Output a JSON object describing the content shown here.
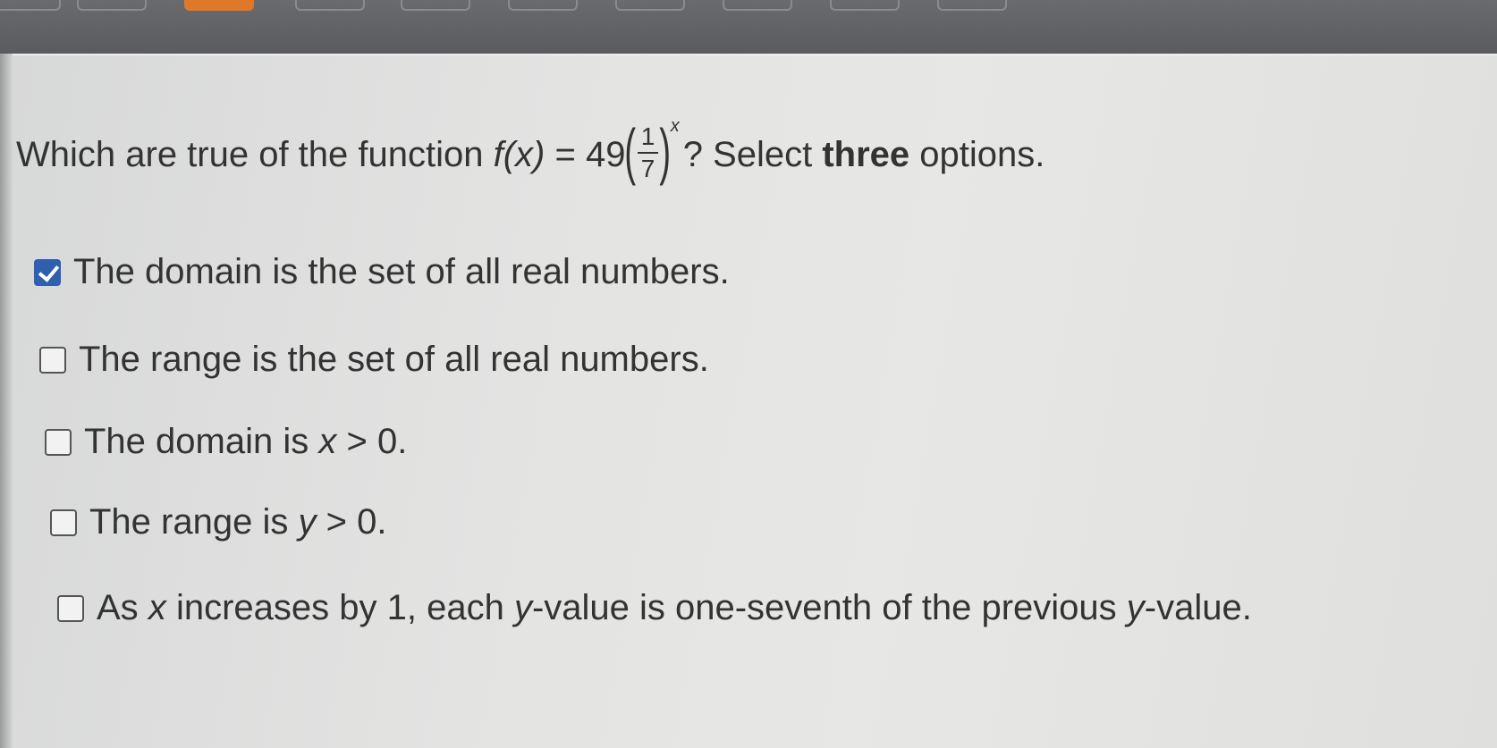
{
  "question": {
    "prefix": "Which are true of the function",
    "function_name": "f(x)",
    "equals": "= 49",
    "fraction_numerator": "1",
    "fraction_denominator": "7",
    "exponent": "x",
    "suffix_a": "? Select",
    "suffix_bold": "three",
    "suffix_b": "options."
  },
  "options": [
    {
      "label": "The domain is the set of all real numbers.",
      "checked": true
    },
    {
      "label": "The range is the set of all real numbers.",
      "checked": false
    },
    {
      "label_a": "The domain is",
      "var": "x",
      "label_b": "> 0.",
      "checked": false
    },
    {
      "label_a": "The range is",
      "var": "y",
      "label_b": "> 0.",
      "checked": false
    },
    {
      "label_a": "As",
      "var1": "x",
      "label_b": "increases by 1, each",
      "var2": "y",
      "label_c": "-value is one-seventh of the previous",
      "var3": "y",
      "label_d": "-value.",
      "checked": false
    }
  ],
  "colors": {
    "checked_box": "#2f5fae",
    "active_tab": "#e0782a",
    "panel": "#e3e3e2"
  }
}
